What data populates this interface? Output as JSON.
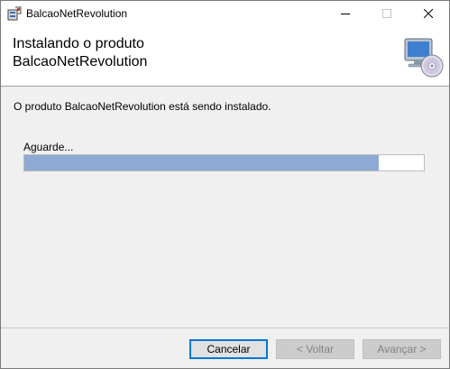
{
  "window": {
    "title": "BalcaoNetRevolution",
    "icon": "installer-package-icon"
  },
  "banner": {
    "title_line1": "Instalando o produto",
    "title_line2": "BalcaoNetRevolution",
    "art_icon": "computer-cd-icon"
  },
  "status": {
    "message": "O produto BalcaoNetRevolution está sendo instalado.",
    "wait_label": "Aguarde..."
  },
  "progress": {
    "fraction": 0.887,
    "color": "#8eaad4"
  },
  "buttons": {
    "cancel": "Cancelar",
    "back": "< Voltar",
    "next": "Avançar >"
  },
  "colors": {
    "accent": "#0078d7",
    "window_bg": "#f0f0f0"
  }
}
